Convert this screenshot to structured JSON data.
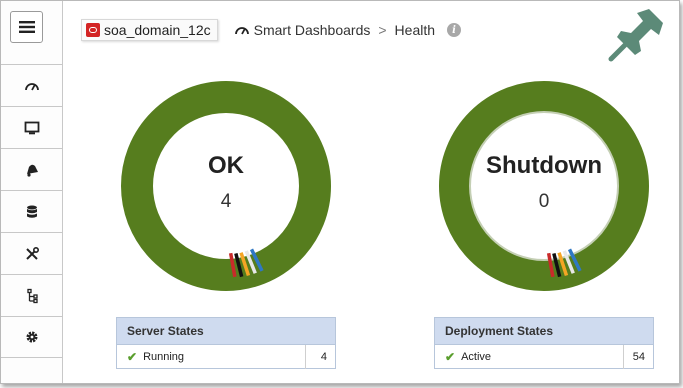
{
  "header": {
    "domain": "soa_domain_12c",
    "breadcrumb_root": "Smart Dashboards",
    "breadcrumb_separator": ">",
    "breadcrumb_current": "Health",
    "info_glyph": "i"
  },
  "sidebar": {
    "items": [
      {
        "icon": "dashboard-gauge-icon"
      },
      {
        "icon": "monitor-icon"
      },
      {
        "icon": "alerts-bell-icon"
      },
      {
        "icon": "database-icon"
      },
      {
        "icon": "tools-icon"
      },
      {
        "icon": "hierarchy-icon"
      },
      {
        "icon": "gear-icon"
      }
    ]
  },
  "colors": {
    "ring_green": "#567d1e",
    "header_blue": "#cfdbef",
    "check_green": "#5a9e2d",
    "pin_teal": "#5c8a78",
    "oracle_red": "#d32323"
  },
  "gauges": [
    {
      "status": "OK",
      "count": "4"
    },
    {
      "status": "Shutdown",
      "count": "0"
    }
  ],
  "tables": [
    {
      "title": "Server States",
      "rows": [
        {
          "label": "Running",
          "count": "4"
        }
      ]
    },
    {
      "title": "Deployment States",
      "rows": [
        {
          "label": "Active",
          "count": "54"
        }
      ]
    }
  ]
}
